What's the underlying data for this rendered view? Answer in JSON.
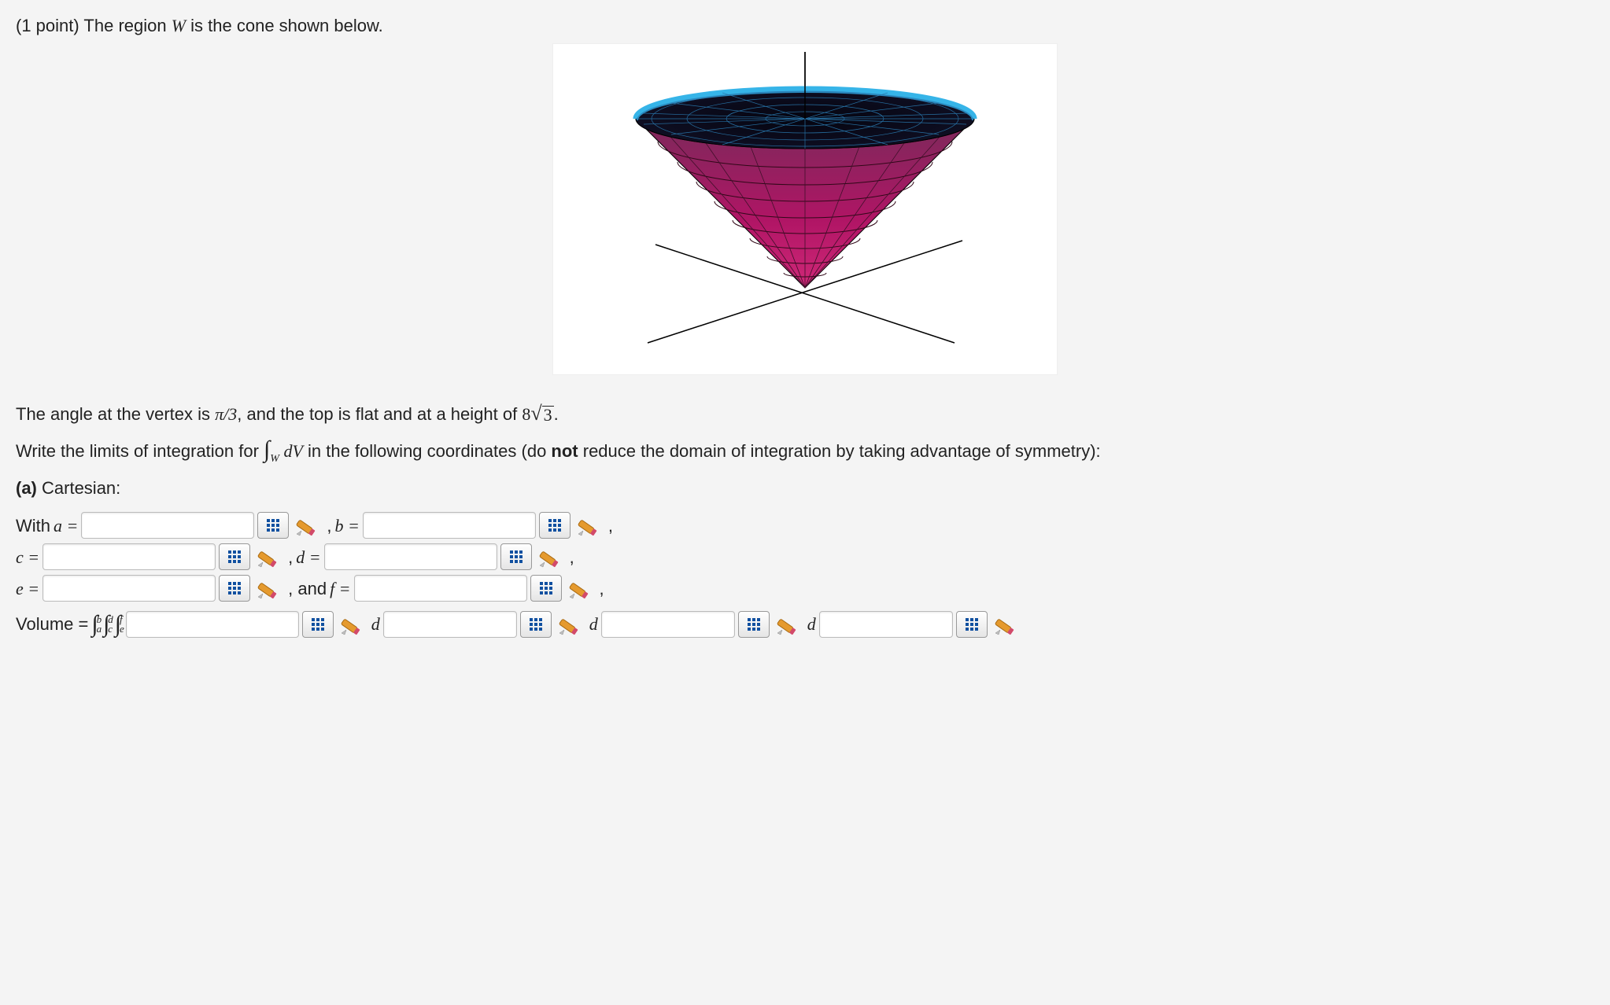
{
  "intro": {
    "points_prefix": "(1 point) ",
    "line1_a": "The region ",
    "line1_W": "W",
    "line1_b": " is the cone shown below."
  },
  "desc": {
    "part1": "The angle at the vertex is ",
    "angle": "π/3",
    "part2": ", and the top is flat and at a height of ",
    "height_coeff": "8",
    "height_rad": "3",
    "part3": "."
  },
  "instr": {
    "part1": "Write the limits of integration for ",
    "int_sub": "W",
    "int_dv": " dV",
    "part2": " in the following coordinates (do ",
    "not": "not",
    "part3": " reduce the domain of integration by taking advantage of symmetry):"
  },
  "partA": {
    "label": "(a)",
    "title": " Cartesian:"
  },
  "labels": {
    "with": "With ",
    "a_eq": "a = ",
    "b_eq": "b = ",
    "c_eq": "c = ",
    "d_eq": "d = ",
    "e_eq": "e = ",
    "f_eq": "f = ",
    "and": ", and ",
    "comma_space": " , ",
    "volume": "Volume = ",
    "differential": "d"
  },
  "integral_triple": {
    "outer_lo": "a",
    "outer_hi": "b",
    "mid_lo": "c",
    "mid_hi": "d",
    "inner_lo": "e",
    "inner_hi": "f"
  },
  "chart_data": {
    "type": "3d-surface",
    "description": "Inverted circular cone with apex at origin, opening upward, flat circular top",
    "vertex_angle_rad": 1.0472,
    "vertex_angle_label": "π/3",
    "height": 13.8564,
    "height_label": "8√3",
    "top_radius": 8,
    "colors": {
      "rim": "#3aa8d8",
      "side_top": "#7a2a5a",
      "side_bottom": "#c02070",
      "top_face": "#0a0a14"
    }
  }
}
